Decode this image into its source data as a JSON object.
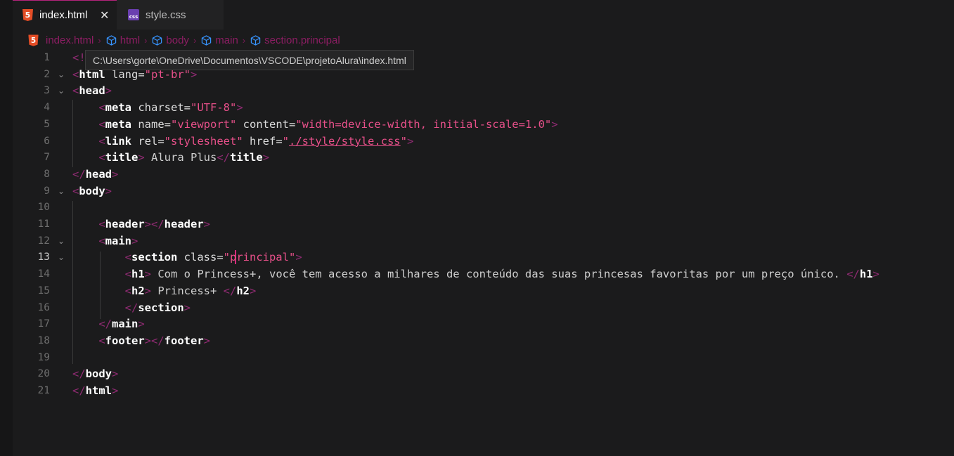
{
  "tabs": [
    {
      "label": "index.html",
      "icon": "html5-icon",
      "active": true
    },
    {
      "label": "style.css",
      "icon": "css-icon",
      "active": false
    }
  ],
  "tab_close_glyph": "✕",
  "icon_text": {
    "html5": "5",
    "css": "css"
  },
  "breadcrumb": [
    "index.html",
    "html",
    "body",
    "main",
    "section.principal"
  ],
  "breadcrumb_sep": "›",
  "tooltip": "C:\\Users\\gorte\\OneDrive\\Documentos\\VSCODE\\projetoAlura\\index.html",
  "fold_glyph": "⌄",
  "current_line": 13,
  "lines": [
    {
      "n": "1",
      "fold": false,
      "parts": [
        [
          "t",
          "<!"
        ]
      ]
    },
    {
      "n": "2",
      "fold": true,
      "parts": [
        [
          "t",
          "<"
        ],
        [
          "tn",
          "html"
        ],
        [
          "an",
          " lang="
        ],
        [
          "av",
          "\"pt-br\""
        ],
        [
          "t",
          ">"
        ]
      ]
    },
    {
      "n": "3",
      "fold": true,
      "parts": [
        [
          "t",
          "<"
        ],
        [
          "tn",
          "head"
        ],
        [
          "t",
          ">"
        ]
      ]
    },
    {
      "n": "4",
      "fold": false,
      "parts": [
        [
          "x",
          "    "
        ],
        [
          "t",
          "<"
        ],
        [
          "tn",
          "meta"
        ],
        [
          "an",
          " charset="
        ],
        [
          "av",
          "\"UTF-8\""
        ],
        [
          "t",
          ">"
        ]
      ]
    },
    {
      "n": "5",
      "fold": false,
      "parts": [
        [
          "x",
          "    "
        ],
        [
          "t",
          "<"
        ],
        [
          "tn",
          "meta"
        ],
        [
          "an",
          " name="
        ],
        [
          "av",
          "\"viewport\""
        ],
        [
          "an",
          " content="
        ],
        [
          "av",
          "\"width=device-width, initial-scale=1.0\""
        ],
        [
          "t",
          ">"
        ]
      ]
    },
    {
      "n": "6",
      "fold": false,
      "parts": [
        [
          "x",
          "    "
        ],
        [
          "t",
          "<"
        ],
        [
          "tn",
          "link"
        ],
        [
          "an",
          " rel="
        ],
        [
          "av",
          "\"stylesheet\""
        ],
        [
          "an",
          " href="
        ],
        [
          "av",
          "\""
        ],
        [
          "avu",
          "./style/style.css"
        ],
        [
          "av",
          "\""
        ],
        [
          "t",
          ">"
        ]
      ]
    },
    {
      "n": "7",
      "fold": false,
      "parts": [
        [
          "x",
          "    "
        ],
        [
          "t",
          "<"
        ],
        [
          "tn",
          "title"
        ],
        [
          "t",
          ">"
        ],
        [
          "tx",
          " Alura Plus"
        ],
        [
          "t",
          "</"
        ],
        [
          "tn",
          "title"
        ],
        [
          "t",
          ">"
        ]
      ]
    },
    {
      "n": "8",
      "fold": false,
      "parts": [
        [
          "t",
          "</"
        ],
        [
          "tn",
          "head"
        ],
        [
          "t",
          ">"
        ]
      ]
    },
    {
      "n": "9",
      "fold": true,
      "parts": [
        [
          "t",
          "<"
        ],
        [
          "tn",
          "body"
        ],
        [
          "t",
          ">"
        ]
      ]
    },
    {
      "n": "10",
      "fold": false,
      "parts": []
    },
    {
      "n": "11",
      "fold": false,
      "parts": [
        [
          "x",
          "    "
        ],
        [
          "t",
          "<"
        ],
        [
          "tn",
          "header"
        ],
        [
          "t",
          "></"
        ],
        [
          "tn",
          "header"
        ],
        [
          "t",
          ">"
        ]
      ]
    },
    {
      "n": "12",
      "fold": true,
      "parts": [
        [
          "x",
          "    "
        ],
        [
          "t",
          "<"
        ],
        [
          "tn",
          "main"
        ],
        [
          "t",
          ">"
        ]
      ]
    },
    {
      "n": "13",
      "fold": true,
      "parts": [
        [
          "x",
          "        "
        ],
        [
          "t",
          "<"
        ],
        [
          "tn",
          "section"
        ],
        [
          "an",
          " class="
        ],
        [
          "av",
          "\"principal\""
        ],
        [
          "t",
          ">"
        ]
      ]
    },
    {
      "n": "14",
      "fold": false,
      "parts": [
        [
          "x",
          "        "
        ],
        [
          "t",
          "<"
        ],
        [
          "tn",
          "h1"
        ],
        [
          "t",
          ">"
        ],
        [
          "tx",
          " Com o Princess+, você tem acesso a milhares de conteúdo das suas princesas favoritas por um preço único. "
        ],
        [
          "t",
          "</"
        ],
        [
          "tn",
          "h1"
        ],
        [
          "t",
          ">"
        ]
      ]
    },
    {
      "n": "15",
      "fold": false,
      "parts": [
        [
          "x",
          "        "
        ],
        [
          "t",
          "<"
        ],
        [
          "tn",
          "h2"
        ],
        [
          "t",
          ">"
        ],
        [
          "tx",
          " Princess+ "
        ],
        [
          "t",
          "</"
        ],
        [
          "tn",
          "h2"
        ],
        [
          "t",
          ">"
        ]
      ]
    },
    {
      "n": "16",
      "fold": false,
      "parts": [
        [
          "x",
          "        "
        ],
        [
          "t",
          "</"
        ],
        [
          "tn",
          "section"
        ],
        [
          "t",
          ">"
        ]
      ]
    },
    {
      "n": "17",
      "fold": false,
      "parts": [
        [
          "x",
          "    "
        ],
        [
          "t",
          "</"
        ],
        [
          "tn",
          "main"
        ],
        [
          "t",
          ">"
        ]
      ]
    },
    {
      "n": "18",
      "fold": false,
      "parts": [
        [
          "x",
          "    "
        ],
        [
          "t",
          "<"
        ],
        [
          "tn",
          "footer"
        ],
        [
          "t",
          "></"
        ],
        [
          "tn",
          "footer"
        ],
        [
          "t",
          ">"
        ]
      ]
    },
    {
      "n": "19",
      "fold": false,
      "parts": []
    },
    {
      "n": "20",
      "fold": false,
      "parts": [
        [
          "t",
          "</"
        ],
        [
          "tn",
          "body"
        ],
        [
          "t",
          ">"
        ]
      ]
    },
    {
      "n": "21",
      "fold": false,
      "parts": [
        [
          "t",
          "</"
        ],
        [
          "tn",
          "html"
        ],
        [
          "t",
          ">"
        ]
      ]
    }
  ],
  "colors": {
    "background": "#1b1b1c",
    "accent": "#b4237c",
    "tag_bracket": "#8f2b72",
    "attribute_value": "#e8508a",
    "html5_icon": "#e44d26",
    "css_icon": "#6a3fb0",
    "breadcrumb_text": "#8b1d62",
    "cube_icon": "#3794ff"
  }
}
